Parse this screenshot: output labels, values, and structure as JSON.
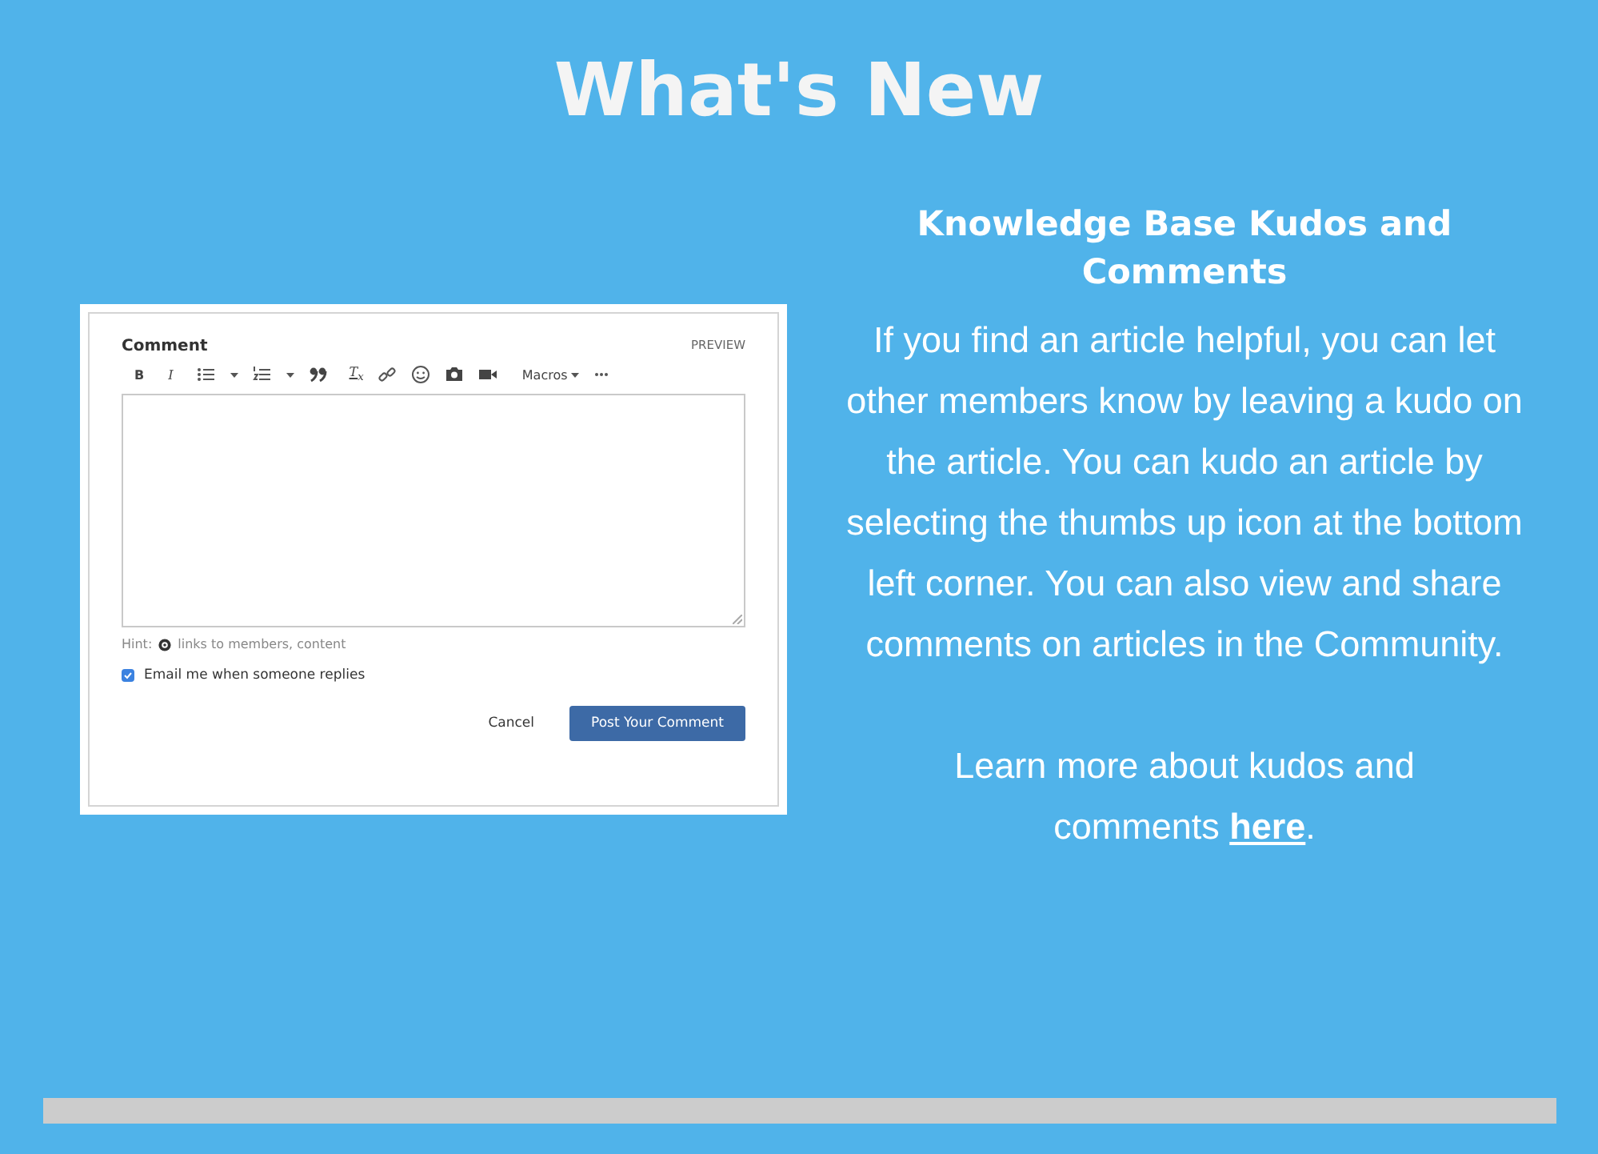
{
  "title": "What's New",
  "comment_box": {
    "label": "Comment",
    "preview": "PREVIEW",
    "toolbar": {
      "bold": "B",
      "italic": "I",
      "clear_format": "T$_{x}$",
      "macros": "Macros"
    },
    "hint_label": "Hint:",
    "hint": "links to members, content",
    "email_option": {
      "label": "Email me when someone replies",
      "checked": true
    },
    "cancel": "Cancel",
    "submit": "Post Your Comment"
  },
  "article": {
    "heading": "Knowledge Base Kudos and Comments",
    "body": "If you find an article helpful, you can let other members know by leaving a kudo on the article.  You can kudo an article by selecting the thumbs up icon at the bottom left corner.  You can also view and share comments on articles in the Community.",
    "learn_more": {
      "before": "Learn more about kudos and comments ",
      "link": "here",
      "after": "."
    }
  }
}
